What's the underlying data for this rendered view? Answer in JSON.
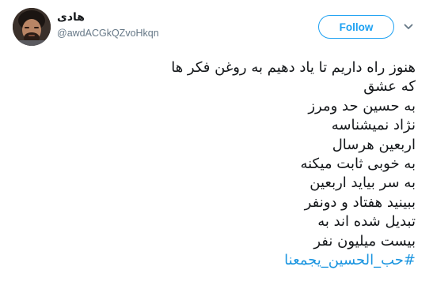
{
  "user": {
    "display_name": "هادی",
    "screen_name": "@awdACGkQZvoHkqn",
    "avatar_icon": "user-avatar-photo"
  },
  "actions": {
    "follow_label": "Follow",
    "more_icon": "chevron-down-icon"
  },
  "tweet": {
    "lines": [
      "هنوز راه داریم تا یاد دهیم به روغن فکر ها",
      "که عشق",
      "به حسین حد ومرز",
      "نژاد نمیشناسه",
      "اربعین هرسال",
      "به خوبی ثابت میکنه",
      "به سر بیاید اربعین",
      "ببینید هفتاد و دونفر",
      "تبدیل شده اند به",
      "بیست میلیون نفر"
    ],
    "hashtag": "#حب_الحسين_يجمعنا"
  },
  "colors": {
    "brand_blue": "#1da1f2",
    "link_blue": "#1b95e0",
    "text": "#14171a",
    "secondary_text": "#657786"
  }
}
